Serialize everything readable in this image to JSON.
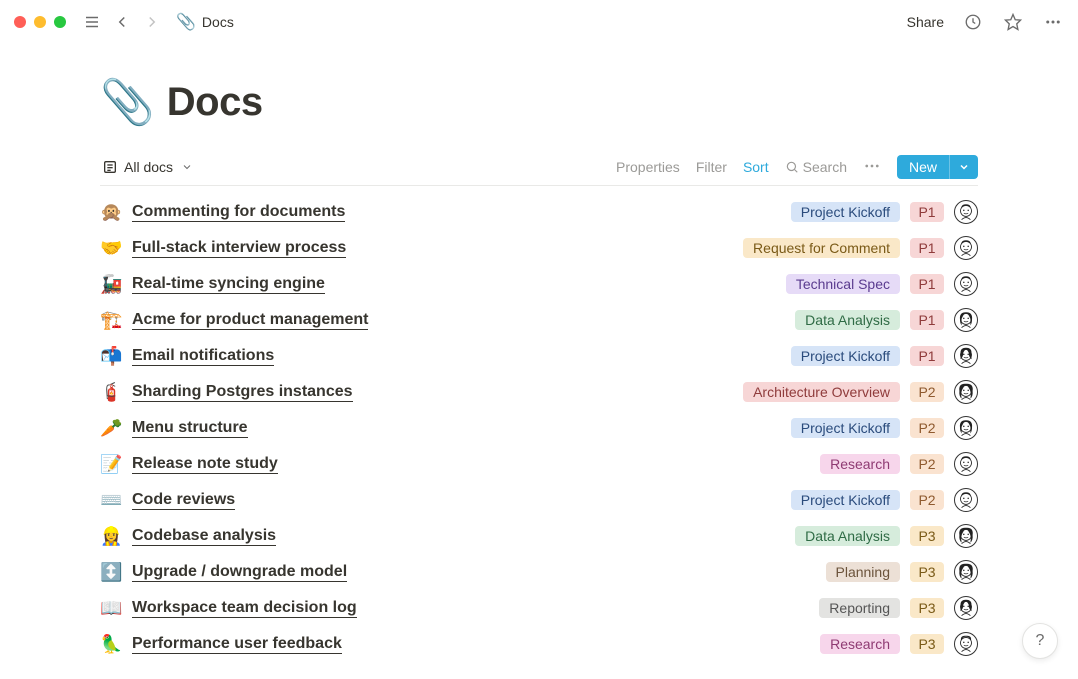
{
  "breadcrumb": {
    "icon": "📎",
    "title": "Docs"
  },
  "top": {
    "share": "Share"
  },
  "page": {
    "icon": "📎",
    "title": "Docs"
  },
  "viewbar": {
    "view_label": "All docs",
    "properties": "Properties",
    "filter": "Filter",
    "sort": "Sort",
    "search": "Search",
    "new": "New"
  },
  "tag_colors": {
    "Project Kickoff": {
      "bg": "#d6e4f7",
      "fg": "#2a4b7c"
    },
    "Request for Comment": {
      "bg": "#fae8c8",
      "fg": "#7a5a17"
    },
    "Technical Spec": {
      "bg": "#e6dbf7",
      "fg": "#5a3b8f"
    },
    "Data Analysis": {
      "bg": "#d6ecdc",
      "fg": "#2f6b45"
    },
    "Architecture Overview": {
      "bg": "#f7d6d6",
      "fg": "#8f3b3b"
    },
    "Research": {
      "bg": "#f7d6eb",
      "fg": "#8f3b73"
    },
    "Planning": {
      "bg": "#ece0d6",
      "fg": "#6b533b"
    },
    "Reporting": {
      "bg": "#e3e3e1",
      "fg": "#555"
    }
  },
  "priority_colors": {
    "P1": {
      "bg": "#f7d6d6",
      "fg": "#8f3b3b"
    },
    "P2": {
      "bg": "#fae3d0",
      "fg": "#8f5a2f"
    },
    "P3": {
      "bg": "#fae8c8",
      "fg": "#7a5a17"
    }
  },
  "avatar_styles": {
    "m1": {
      "hair": "short"
    },
    "f1": {
      "hair": "wavy"
    },
    "f2": {
      "hair": "curly"
    },
    "f3": {
      "hair": "bob"
    },
    "m2": {
      "hair": "curlytop"
    }
  },
  "rows": [
    {
      "icon": "🙊",
      "title": "Commenting for documents",
      "tag": "Project Kickoff",
      "priority": "P1",
      "avatar": "m1"
    },
    {
      "icon": "🤝",
      "title": "Full-stack interview process",
      "tag": "Request for Comment",
      "priority": "P1",
      "avatar": "m1"
    },
    {
      "icon": "🚂",
      "title": "Real-time syncing engine",
      "tag": "Technical Spec",
      "priority": "P1",
      "avatar": "m1"
    },
    {
      "icon": "🏗️",
      "title": "Acme for product management",
      "tag": "Data Analysis",
      "priority": "P1",
      "avatar": "f1"
    },
    {
      "icon": "📬",
      "title": "Email notifications",
      "tag": "Project Kickoff",
      "priority": "P1",
      "avatar": "f3"
    },
    {
      "icon": "🧯",
      "title": "Sharding Postgres instances",
      "tag": "Architecture Overview",
      "priority": "P2",
      "avatar": "f2"
    },
    {
      "icon": "🥕",
      "title": "Menu structure",
      "tag": "Project Kickoff",
      "priority": "P2",
      "avatar": "f1"
    },
    {
      "icon": "📝",
      "title": "Release note study",
      "tag": "Research",
      "priority": "P2",
      "avatar": "m1"
    },
    {
      "icon": "⌨️",
      "title": "Code reviews",
      "tag": "Project Kickoff",
      "priority": "P2",
      "avatar": "m1"
    },
    {
      "icon": "👷‍♀️",
      "title": "Codebase analysis",
      "tag": "Data Analysis",
      "priority": "P3",
      "avatar": "f2"
    },
    {
      "icon": "↕️",
      "title": "Upgrade / downgrade model",
      "tag": "Planning",
      "priority": "P3",
      "avatar": "f2"
    },
    {
      "icon": "📖",
      "title": "Workspace team decision log",
      "tag": "Reporting",
      "priority": "P3",
      "avatar": "f3"
    },
    {
      "icon": "🦜",
      "title": "Performance user feedback",
      "tag": "Research",
      "priority": "P3",
      "avatar": "m2"
    }
  ],
  "help": "?"
}
